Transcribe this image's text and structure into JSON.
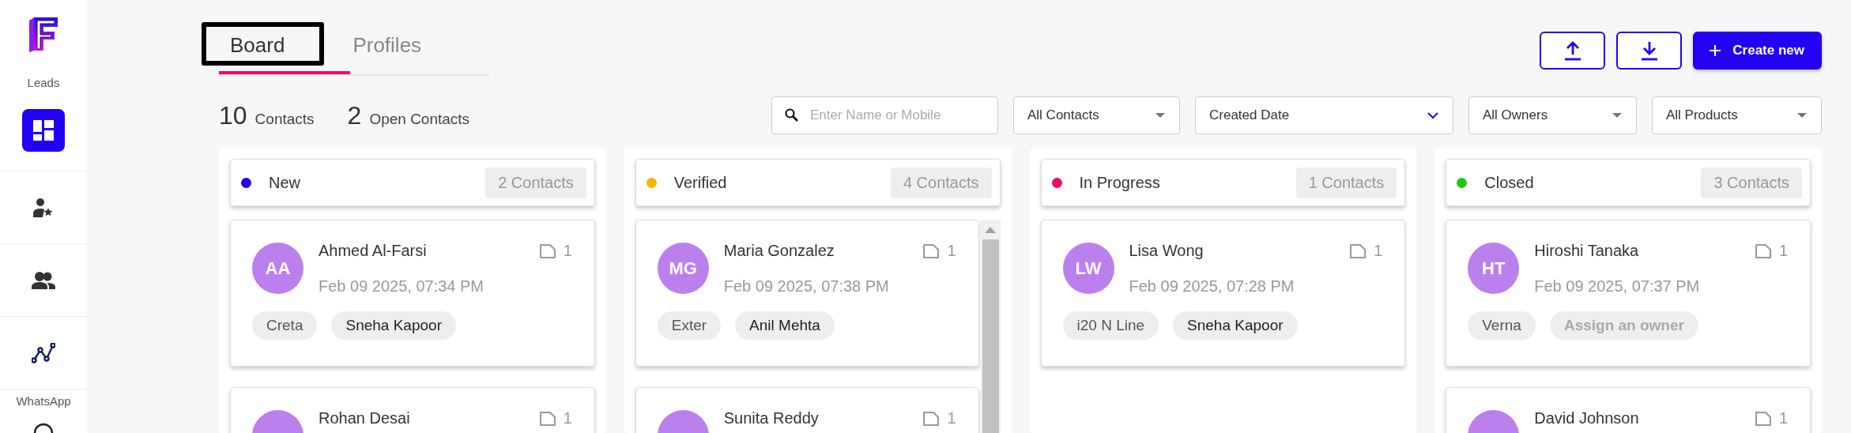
{
  "sidebar": {
    "title": "Leads",
    "items": [
      {
        "kind": "dashboard",
        "selected": true
      },
      {
        "kind": "person-star",
        "selected": false
      },
      {
        "kind": "people",
        "selected": false
      },
      {
        "kind": "chart",
        "selected": false
      }
    ],
    "section_label": "WhatsApp",
    "bottom_item": {
      "kind": "circle"
    }
  },
  "tabs": [
    {
      "label": "Board",
      "selected": true
    },
    {
      "label": "Profiles",
      "selected": false
    }
  ],
  "actions": [
    {
      "kind": "upload"
    },
    {
      "kind": "download"
    },
    {
      "kind": "create",
      "label": "Create new"
    }
  ],
  "stats": [
    {
      "value": "10",
      "label": "Contacts"
    },
    {
      "value": "2",
      "label": "Open Contacts"
    }
  ],
  "search": {
    "placeholder": "Enter Name or Mobile"
  },
  "filters": [
    {
      "kind": "dropdown",
      "value": "All Contacts"
    },
    {
      "kind": "date",
      "value": "Created Date"
    },
    {
      "kind": "dropdown",
      "value": "All Owners"
    },
    {
      "kind": "dropdown",
      "value": "All Products"
    }
  ],
  "columns": [
    {
      "name": "New",
      "color": "#2200ee",
      "count": "2 Contacts",
      "scrollbar": false,
      "cards": [
        {
          "initials": "AA",
          "name": "Ahmed Al-Farsi",
          "notes": "1",
          "date": "Feb 09 2025, 07:34 PM",
          "tags": [
            {
              "kind": "product",
              "text": "Creta"
            },
            {
              "kind": "owner",
              "text": "Sneha Kapoor"
            }
          ]
        },
        {
          "name": "Rohan Desai",
          "notes": "1"
        }
      ]
    },
    {
      "name": "Verified",
      "color": "#f5b400",
      "count": "4 Contacts",
      "scrollbar": true,
      "cards": [
        {
          "initials": "MG",
          "name": "Maria Gonzalez",
          "notes": "1",
          "date": "Feb 09 2025, 07:38 PM",
          "tags": [
            {
              "kind": "product",
              "text": "Exter"
            },
            {
              "kind": "owner",
              "text": "Anil Mehta"
            }
          ]
        },
        {
          "name": "Sunita Reddy",
          "notes": "1"
        }
      ]
    },
    {
      "name": "In Progress",
      "color": "#ee0a64",
      "count": "1 Contacts",
      "scrollbar": false,
      "cards": [
        {
          "initials": "LW",
          "name": "Lisa Wong",
          "notes": "1",
          "date": "Feb 09 2025, 07:28 PM",
          "tags": [
            {
              "kind": "product",
              "text": "i20 N Line"
            },
            {
              "kind": "owner",
              "text": "Sneha Kapoor"
            }
          ]
        }
      ]
    },
    {
      "name": "Closed",
      "color": "#22c414",
      "count": "3 Contacts",
      "scrollbar": false,
      "cards": [
        {
          "initials": "HT",
          "name": "Hiroshi Tanaka",
          "notes": "1",
          "date": "Feb 09 2025, 07:37 PM",
          "tags": [
            {
              "kind": "product",
              "text": "Verna"
            },
            {
              "kind": "unassigned",
              "text": "Assign an owner"
            }
          ]
        },
        {
          "name": "David Johnson",
          "notes": "1"
        }
      ]
    }
  ]
}
